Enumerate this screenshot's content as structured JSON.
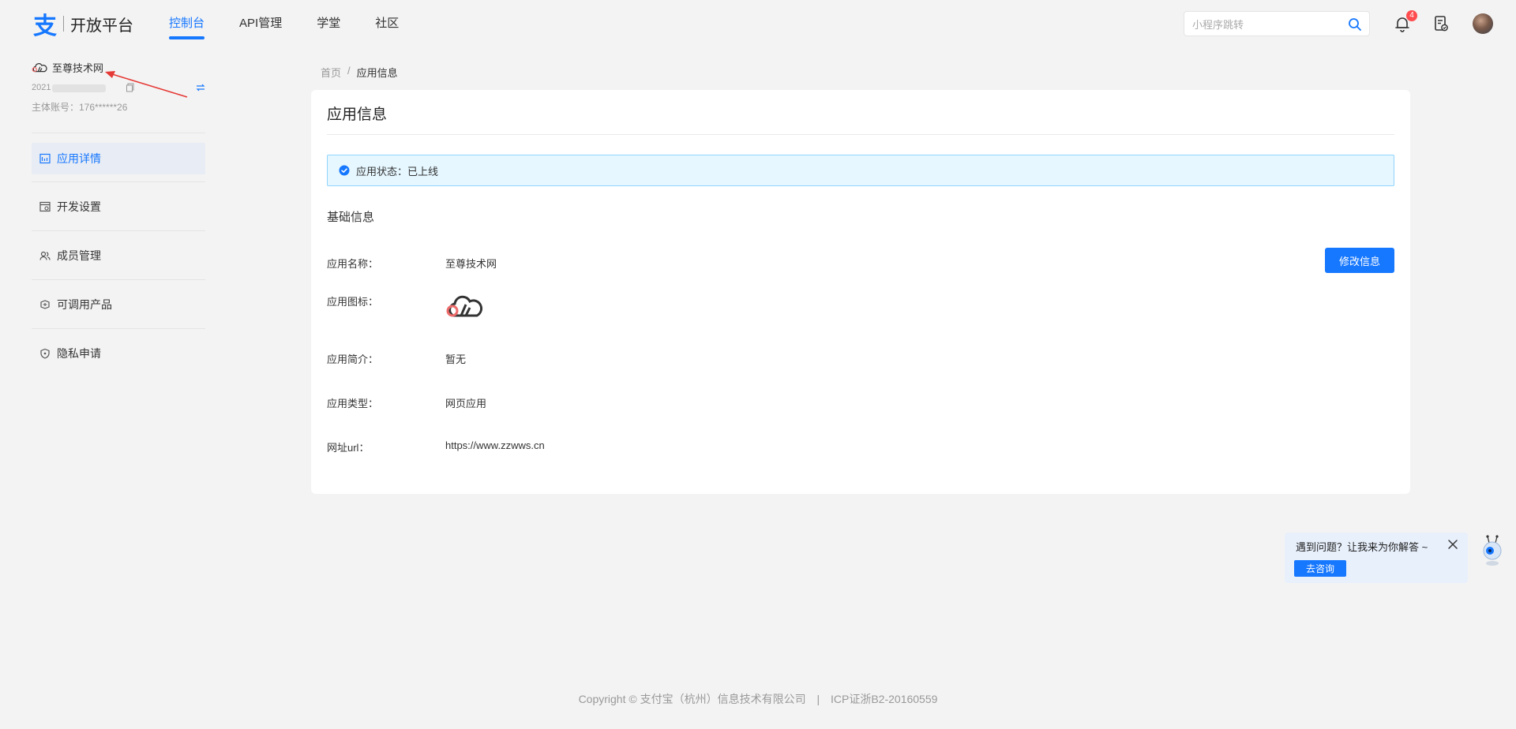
{
  "header": {
    "logo_text": "开放平台",
    "nav": [
      "控制台",
      "API管理",
      "学堂",
      "社区"
    ],
    "search_placeholder": "小程序跳转",
    "notification_count": "4",
    "accent": "#1677ff"
  },
  "sidebar": {
    "app_name": "至尊技术网",
    "app_id_prefix": "2021",
    "owner_account": "主体账号：176******26",
    "menu": [
      "应用详情",
      "开发设置",
      "成员管理",
      "可调用产品",
      "隐私申请"
    ]
  },
  "breadcrumb": {
    "home": "首页",
    "separator": "/",
    "current": "应用信息"
  },
  "card": {
    "title": "应用信息",
    "status": "应用状态：已上线",
    "section_title": "基础信息",
    "edit_button": "修改信息",
    "fields": {
      "name": {
        "label": "应用名称：",
        "value": "至尊技术网"
      },
      "icon": {
        "label": "应用图标："
      },
      "intro": {
        "label": "应用简介：",
        "value": "暂无"
      },
      "type": {
        "label": "应用类型：",
        "value": "网页应用"
      },
      "url": {
        "label": "网址url：",
        "value": "https://www.zzwws.cn"
      }
    }
  },
  "help": {
    "text": "遇到问题？让我来为你解答 ~",
    "button": "去咨询"
  },
  "footer": {
    "copyright": "Copyright © 支付宝（杭州）信息技术有限公司",
    "separator": "|",
    "icp": "ICP证浙B2-20160559"
  }
}
